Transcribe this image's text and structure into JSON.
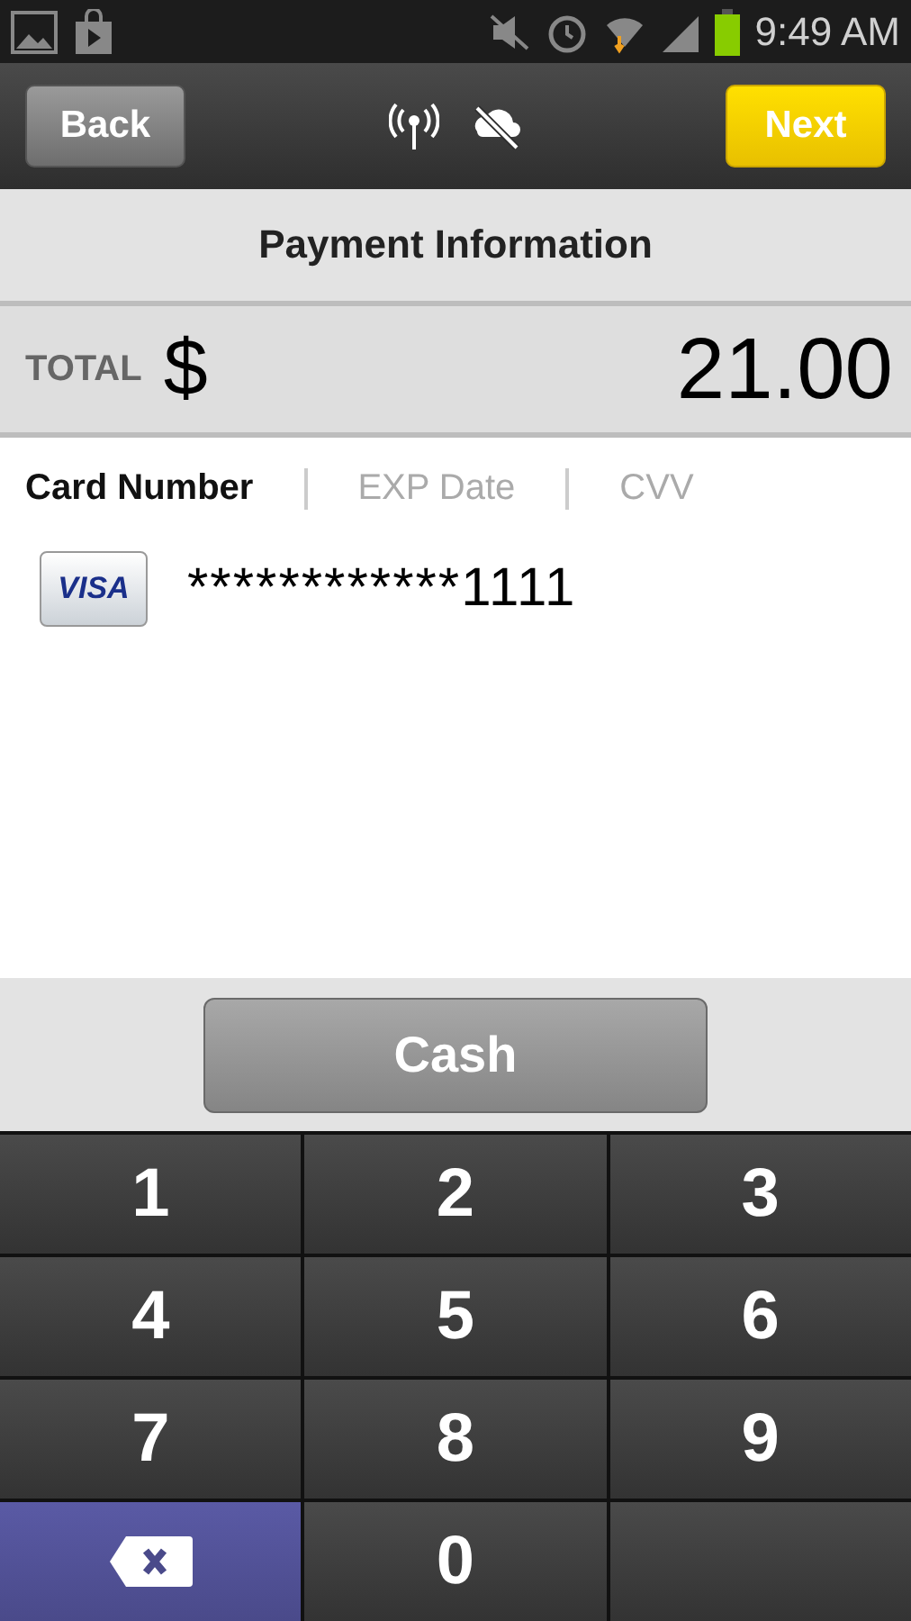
{
  "status_bar": {
    "time": "9:49 AM"
  },
  "toolbar": {
    "back": "Back",
    "next": "Next"
  },
  "title": "Payment Information",
  "total": {
    "label": "TOTAL",
    "currency": "$",
    "amount": "21.00"
  },
  "tabs": [
    {
      "label": "Card Number",
      "selected": true
    },
    {
      "label": "EXP Date",
      "selected": false
    },
    {
      "label": "CVV",
      "selected": false
    }
  ],
  "card": {
    "brand": "VISA",
    "number": "************1111"
  },
  "cash_button": "Cash",
  "keys": [
    {
      "kind": "digit",
      "label": "1"
    },
    {
      "kind": "digit",
      "label": "2"
    },
    {
      "kind": "digit",
      "label": "3"
    },
    {
      "kind": "digit",
      "label": "4"
    },
    {
      "kind": "digit",
      "label": "5"
    },
    {
      "kind": "digit",
      "label": "6"
    },
    {
      "kind": "digit",
      "label": "7"
    },
    {
      "kind": "digit",
      "label": "8"
    },
    {
      "kind": "digit",
      "label": "9"
    },
    {
      "kind": "backspace"
    },
    {
      "kind": "digit",
      "label": "0"
    },
    {
      "kind": "blank"
    }
  ]
}
